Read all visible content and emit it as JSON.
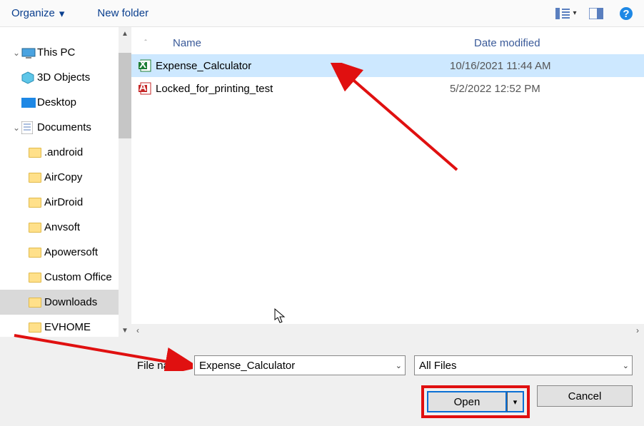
{
  "toolbar": {
    "organize": "Organize",
    "newfolder": "New folder"
  },
  "nav": [
    {
      "label": "This PC",
      "chev": "v",
      "icon": "pc"
    },
    {
      "label": "3D Objects",
      "chev": "",
      "icon": "3d"
    },
    {
      "label": "Desktop",
      "chev": "",
      "icon": "desktop"
    },
    {
      "label": "Documents",
      "chev": "v",
      "icon": "docs"
    },
    {
      "label": ".android",
      "indent": true
    },
    {
      "label": "AirCopy",
      "indent": true
    },
    {
      "label": "AirDroid",
      "indent": true
    },
    {
      "label": "Anvsoft",
      "indent": true
    },
    {
      "label": "Apowersoft",
      "indent": true
    },
    {
      "label": "Custom Office",
      "indent": true
    },
    {
      "label": "Downloads",
      "indent": true,
      "sel": true
    },
    {
      "label": "EVHOME",
      "indent": true
    }
  ],
  "columns": {
    "name": "Name",
    "date": "Date modified"
  },
  "files": [
    {
      "name": "Expense_Calculator",
      "date": "10/16/2021 11:44 AM",
      "type": "xlsx",
      "sel": true
    },
    {
      "name": "Locked_for_printing_test",
      "date": "5/2/2022 12:52 PM",
      "type": "pdf",
      "sel": false
    }
  ],
  "filename_label": "File name:",
  "filename_value": "Expense_Calculator",
  "filetype_value": "All Files",
  "open_label": "Open",
  "cancel_label": "Cancel"
}
